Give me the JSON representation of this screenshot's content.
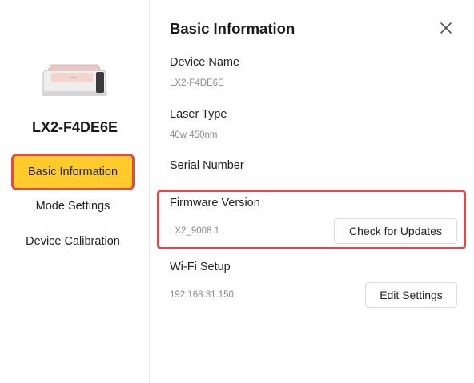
{
  "sidebar": {
    "device_name": "LX2-F4DE6E",
    "nav": [
      {
        "label": "Basic Information",
        "active": true
      },
      {
        "label": "Mode Settings",
        "active": false
      },
      {
        "label": "Device Calibration",
        "active": false
      }
    ]
  },
  "main": {
    "title": "Basic Information",
    "device_name": {
      "label": "Device Name",
      "value": "LX2-F4DE6E"
    },
    "laser_type": {
      "label": "Laser Type",
      "value": "40w 450nm"
    },
    "serial_number": {
      "label": "Serial Number"
    },
    "firmware": {
      "label": "Firmware Version",
      "value": "LX2_9008.1",
      "button": "Check for Updates"
    },
    "wifi": {
      "label": "Wi-Fi Setup",
      "value": "192.168.31.150",
      "button": "Edit Settings"
    }
  },
  "colors": {
    "active_nav": "#ffca2c",
    "highlight": "#e04a4a"
  }
}
